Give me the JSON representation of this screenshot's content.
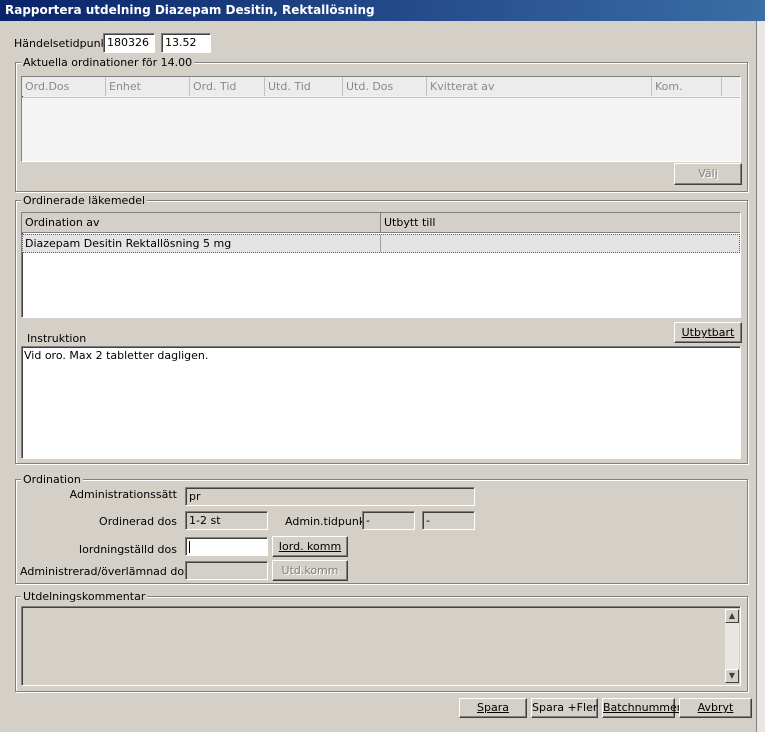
{
  "window": {
    "title": "Rapportera utdelning Diazepam Desitin, Rektallösning"
  },
  "event": {
    "label": "Händelsetidpunkt",
    "date": "180326",
    "time": "13.52"
  },
  "current_orders": {
    "legend": "Aktuella ordinationer för 14.00",
    "columns": [
      "Ord.Dos",
      "Enhet",
      "Ord. Tid",
      "Utd. Tid",
      "Utd. Dos",
      "Kvitterat av",
      "Kom."
    ],
    "select_button": "Välj"
  },
  "prescribed": {
    "legend": "Ordinerade läkemedel",
    "columns": [
      "Ordination av",
      "Utbytt till"
    ],
    "rows": [
      {
        "ordination": "Diazepam Desitin Rektallösning 5 mg",
        "replaced": ""
      }
    ],
    "instruction_label": "Instruktion",
    "exchangeable_button": "Utbytbart",
    "instruction_text": "Vid oro. Max 2 tabletter dagligen."
  },
  "ordination": {
    "legend": "Ordination",
    "admin_method_label": "Administrationssätt",
    "admin_method_value": "pr",
    "ordered_dose_label": "Ordinerad dos",
    "ordered_dose_value": "1-2 st",
    "admin_time_label": "Admin.tidpunkt",
    "admin_time_value1": "-",
    "admin_time_value2": "-",
    "prepared_dose_label": "Iordningställd dos",
    "prepared_dose_value": "",
    "prepared_comment_button": "Iord. komm",
    "administered_label": "Administrerad/överlämnad dos",
    "administered_value": "",
    "utd_comment_button": "Utd.komm"
  },
  "comment": {
    "legend": "Utdelningskommentar",
    "value": ""
  },
  "footer": {
    "save": "Spara",
    "save_more": "Spara +Fler",
    "batch": "Batchnummer",
    "cancel": "Avbryt"
  }
}
